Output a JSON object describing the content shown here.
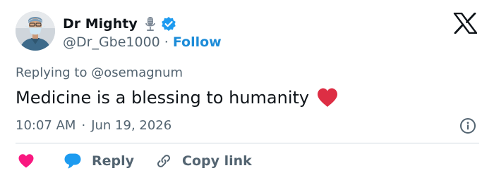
{
  "user": {
    "display_name": "Dr Mighty",
    "handle": "@Dr_Gbe1000",
    "separator": "·",
    "follow_label": "Follow",
    "avatar_icon": "avatar-photo",
    "badges": [
      "microphone-icon",
      "verified-badge-icon"
    ]
  },
  "tweet": {
    "replying_prefix": "Replying to",
    "replying_handle": "@osemagnum",
    "text": "Medicine is a blessing to humanity",
    "emoji": "red-heart",
    "time": "10:07 AM",
    "time_separator": "·",
    "date": "Jun 19, 2026"
  },
  "actions": {
    "like_icon": "heart-icon",
    "reply_label": "Reply",
    "reply_icon": "speech-bubble-icon",
    "copy_label": "Copy link",
    "copy_icon": "link-icon"
  },
  "colors": {
    "follow": "#1d8cd8",
    "verified": "#1d9bf0",
    "heart": "#f91880",
    "emoji_heart": "#dd2e44",
    "muted_text": "#536471",
    "divider": "#cfd9de"
  }
}
